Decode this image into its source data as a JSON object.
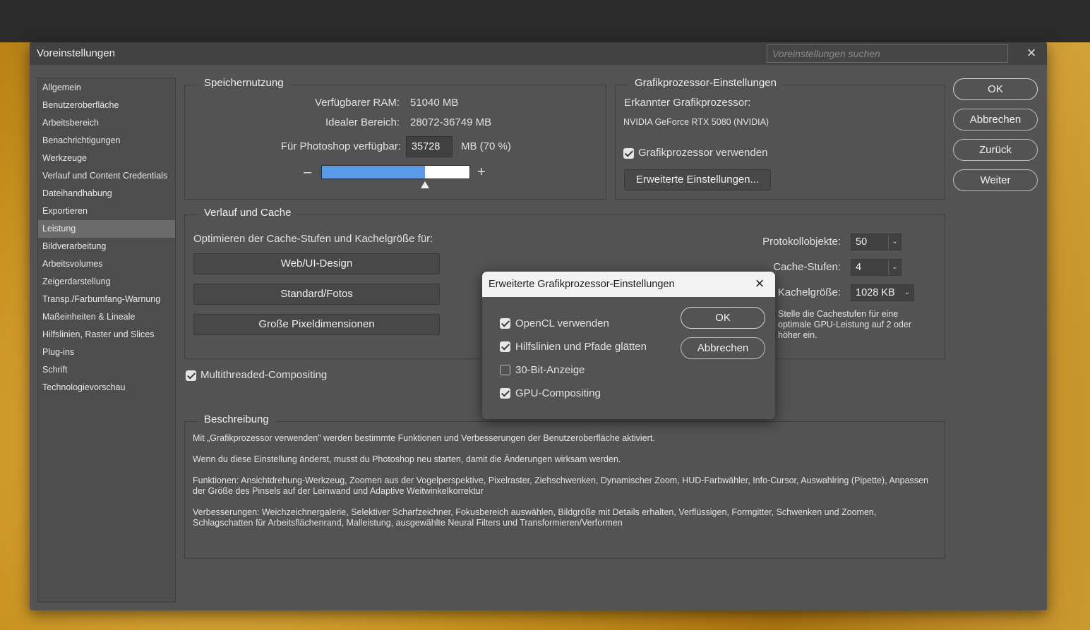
{
  "dialog": {
    "title": "Voreinstellungen",
    "search_placeholder": "Voreinstellungen suchen",
    "close_icon": "×"
  },
  "sidebar": {
    "items": [
      {
        "label": "Allgemein"
      },
      {
        "label": "Benutzeroberfläche"
      },
      {
        "label": "Arbeitsbereich"
      },
      {
        "label": "Benachrichtigungen"
      },
      {
        "label": "Werkzeuge"
      },
      {
        "label": "Verlauf und Content Credentials"
      },
      {
        "label": "Dateihandhabung"
      },
      {
        "label": "Exportieren"
      },
      {
        "label": "Leistung",
        "active": true
      },
      {
        "label": "Bildverarbeitung"
      },
      {
        "label": "Arbeitsvolumes"
      },
      {
        "label": "Zeigerdarstellung"
      },
      {
        "label": "Transp./Farbumfang-Warnung"
      },
      {
        "label": "Maßeinheiten & Lineale"
      },
      {
        "label": "Hilfslinien, Raster und Slices"
      },
      {
        "label": "Plug-ins"
      },
      {
        "label": "Schrift"
      },
      {
        "label": "Technologievorschau"
      }
    ]
  },
  "memory": {
    "legend": "Speichernutzung",
    "ram_label": "Verfügbarer RAM:",
    "ram_value": "51040 MB",
    "ideal_label": "Idealer Bereich:",
    "ideal_value": "28072-36749 MB",
    "ps_label": "Für Photoshop verfügbar:",
    "ps_value": "35728",
    "ps_unit": "MB (70 %)",
    "minus": "–",
    "plus": "+",
    "slider_fraction": 0.7
  },
  "gpu": {
    "legend": "Grafikprozessor-Einstellungen",
    "detected_label": "Erkannter Grafikprozessor:",
    "detected_value": "NVIDIA GeForce RTX 5080 (NVIDIA)",
    "use_gpu_label": "Grafikprozessor verwenden",
    "use_gpu_checked": true,
    "advanced_button": "Erweiterte Einstellungen..."
  },
  "history": {
    "legend": "Verlauf und Cache",
    "optimize_label": "Optimieren der Cache-Stufen und Kachelgröße für:",
    "buttons": [
      "Web/UI-Design",
      "Standard/Fotos",
      "Große Pixeldimensionen"
    ],
    "history_states_label": "Protokollobjekte:",
    "history_states_value": "50",
    "cache_levels_label": "Cache-Stufen:",
    "cache_levels_value": "4",
    "tile_size_label": "Kachelgröße:",
    "tile_size_value": "1028 KB",
    "hint": "Stelle die Cachestufen für eine optimale GPU-Leistung auf 2 oder höher ein."
  },
  "multithreaded": {
    "label": "Multithreaded-Compositing",
    "checked": true
  },
  "description": {
    "legend": "Beschreibung",
    "p1": "Mit „Grafikprozessor verwenden\" werden bestimmte Funktionen und Verbesserungen der Benutzeroberfläche aktiviert.",
    "p2": "Wenn du diese Einstellung änderst, musst du Photoshop neu starten, damit die Änderungen wirksam werden.",
    "p3": "Funktionen: Ansichtdrehung-Werkzeug, Zoomen aus der Vogelperspektive, Pixelraster, Ziehschwenken, Dynamischer Zoom, HUD-Farbwähler, Info-Cursor, Auswahlring (Pipette), Anpassen der Größe des Pinsels auf der Leinwand und Adaptive Weitwinkelkorrektur",
    "p4": "Verbesserungen: Weichzeichnergalerie, Selektiver Scharfzeichner, Fokusbereich auswählen, Bildgröße mit Details erhalten, Verflüssigen, Formgitter, Schwenken und Zoomen, Schlagschatten für Arbeitsflächenrand, Malleistung, ausgewählte Neural Filters und Transformieren/Verformen"
  },
  "actions": {
    "ok": "OK",
    "cancel": "Abbrechen",
    "back": "Zurück",
    "next": "Weiter"
  },
  "advanced_dialog": {
    "title": "Erweiterte Grafikprozessor-Einstellungen",
    "close_icon": "×",
    "options": [
      {
        "label": "OpenCL verwenden",
        "checked": true
      },
      {
        "label": "Hilfslinien und Pfade glätten",
        "checked": true
      },
      {
        "label": "30-Bit-Anzeige",
        "checked": false
      },
      {
        "label": "GPU-Compositing",
        "checked": true
      }
    ],
    "ok": "OK",
    "cancel": "Abbrechen"
  }
}
